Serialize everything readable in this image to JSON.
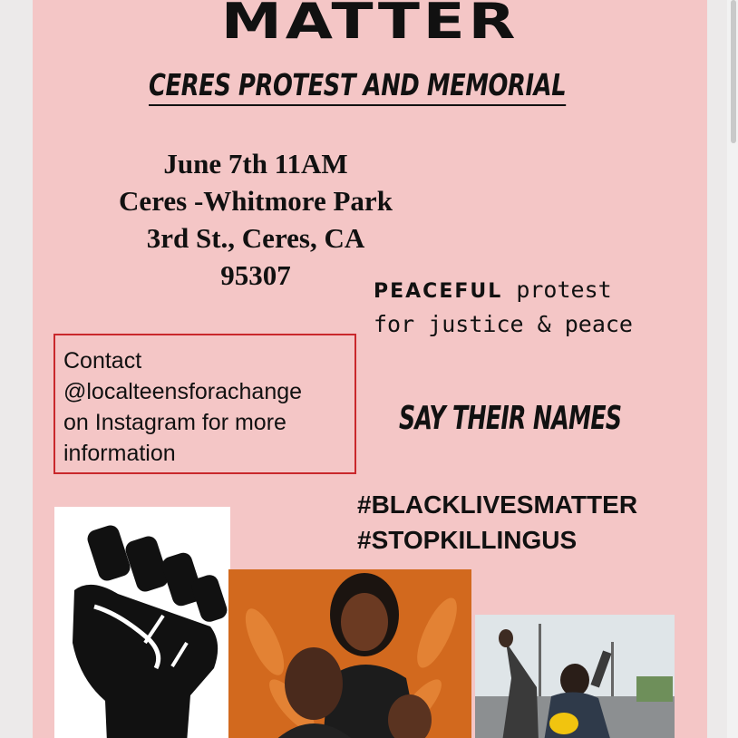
{
  "poster": {
    "headline": "MATTER",
    "subtitle": "CERES PROTEST AND MEMORIAL",
    "event_lines": [
      "June 7th  11AM",
      "Ceres -Whitmore Park",
      "3rd St., Ceres, CA",
      "95307"
    ],
    "peaceful_word": "PEACEFUL",
    "peaceful_rest": "protest",
    "peaceful_line2": "for justice & peace",
    "contact_lines": [
      "Contact",
      "@localteensforachange",
      "on Instagram for more",
      "information"
    ],
    "say_names": "SAY THEIR NAMES",
    "hashtags": [
      "#BLACKLIVESMATTER",
      "#STOPKILLINGUS"
    ]
  },
  "colors": {
    "poster_bg": "#f4c6c6",
    "contact_border": "#c9282c",
    "text": "#111111",
    "portrait_bg": "#d86a1e"
  },
  "icons": {
    "fist": "raised-fist-icon"
  }
}
